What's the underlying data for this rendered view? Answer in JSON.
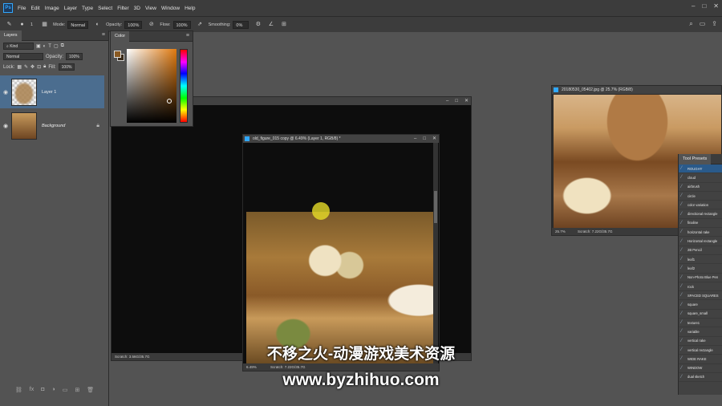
{
  "app": {
    "logo": "Ps",
    "menu": [
      "File",
      "Edit",
      "Image",
      "Layer",
      "Type",
      "Select",
      "Filter",
      "3D",
      "View",
      "Window",
      "Help"
    ],
    "window_controls": [
      "–",
      "□",
      "✕"
    ]
  },
  "options_bar": {
    "brush_size": "1",
    "mode_label": "Mode:",
    "mode_value": "Normal",
    "opacity_label": "Opacity:",
    "opacity_value": "100%",
    "flow_label": "Flow:",
    "flow_value": "100%",
    "smoothing_label": "Smoothing:",
    "smoothing_value": "0%"
  },
  "layers_panel": {
    "tab": "Layers",
    "kind_filter": "Kind",
    "blend_mode": "Normal",
    "opacity_label": "Opacity:",
    "opacity_value": "100%",
    "lock_label": "Lock:",
    "fill_label": "Fill:",
    "fill_value": "100%",
    "layers": [
      {
        "name": "Layer 1",
        "selected": true
      },
      {
        "name": "Background",
        "selected": false,
        "locked": true
      }
    ]
  },
  "color_panel": {
    "tab": "Color",
    "foreground": "#8a5a22",
    "background": "#3a2a18"
  },
  "documents": {
    "large": {
      "status": "Scratch: 3.56G/35.7G"
    },
    "main": {
      "title": "old_figure_015 copy @ 6.49% (Layer 1, RGB/8) *",
      "zoom": "6.49%",
      "status": "Scratch: 7.22G/35.7G"
    },
    "reference": {
      "title": "20180530_05402.jpg @ 25.7% (RGB/8)",
      "zoom": "25.7%",
      "status": "Scratch: 7.22G/35.7G"
    }
  },
  "tool_presets": {
    "tab": "Tool Presets",
    "selected_index": 0,
    "items": [
      "ROUGHY",
      "cloud",
      "airbrush",
      "circle",
      "color variation",
      "directional rectangle",
      "finaline",
      "horizontal rake",
      "Horizontal rectangle",
      "2B Pencil",
      "leaf1",
      "leaf2",
      "Non-Photo Blue Pen",
      "rock",
      "SPACED SQUARES",
      "square",
      "square_small",
      "texture1",
      "variable",
      "vertical rake",
      "vertical rectangle",
      "WIDE RAKE",
      "WINDOW",
      "dual sketch"
    ]
  },
  "watermark": {
    "line1": "不移之火-动漫游戏美术资源",
    "line2": "www.byzhihuo.com"
  }
}
